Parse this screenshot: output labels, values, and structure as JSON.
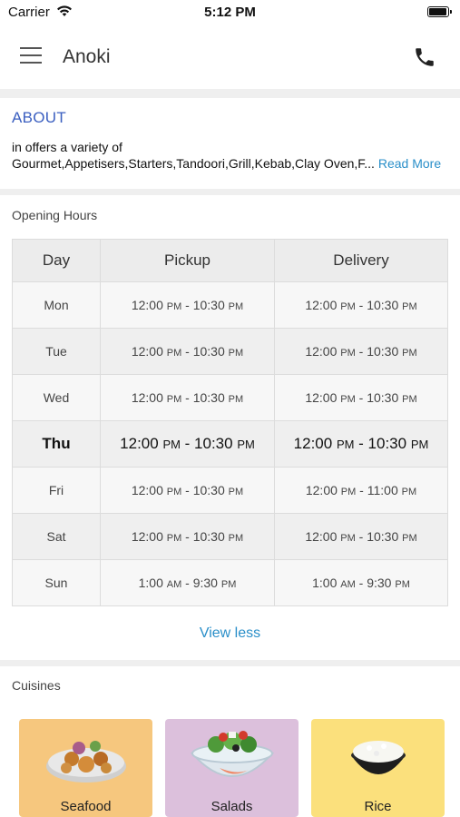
{
  "status_bar": {
    "carrier": "Carrier",
    "time": "5:12 PM"
  },
  "header": {
    "title": "Anoki",
    "menu_icon": "hamburger-icon",
    "call_icon": "phone-icon"
  },
  "about": {
    "heading": "ABOUT",
    "line1": "in  offers a variety of",
    "line2": "Gourmet,Appetisers,Starters,Tandoori,Grill,Kebab,Clay Oven,F...",
    "read_more": "Read More"
  },
  "opening_hours": {
    "heading": "Opening Hours",
    "columns": [
      "Day",
      "Pickup",
      "Delivery"
    ],
    "rows": [
      {
        "day": "Mon",
        "pickup_start": "12:00",
        "pickup_start_ampm": "PM",
        "pickup_end": "10:30",
        "pickup_end_ampm": "PM",
        "delivery_start": "12:00",
        "delivery_start_ampm": "PM",
        "delivery_end": "10:30",
        "delivery_end_ampm": "PM"
      },
      {
        "day": "Tue",
        "pickup_start": "12:00",
        "pickup_start_ampm": "PM",
        "pickup_end": "10:30",
        "pickup_end_ampm": "PM",
        "delivery_start": "12:00",
        "delivery_start_ampm": "PM",
        "delivery_end": "10:30",
        "delivery_end_ampm": "PM"
      },
      {
        "day": "Wed",
        "pickup_start": "12:00",
        "pickup_start_ampm": "PM",
        "pickup_end": "10:30",
        "pickup_end_ampm": "PM",
        "delivery_start": "12:00",
        "delivery_start_ampm": "PM",
        "delivery_end": "10:30",
        "delivery_end_ampm": "PM"
      },
      {
        "day": "Thu",
        "pickup_start": "12:00",
        "pickup_start_ampm": "PM",
        "pickup_end": "10:30",
        "pickup_end_ampm": "PM",
        "delivery_start": "12:00",
        "delivery_start_ampm": "PM",
        "delivery_end": "10:30",
        "delivery_end_ampm": "PM"
      },
      {
        "day": "Fri",
        "pickup_start": "12:00",
        "pickup_start_ampm": "PM",
        "pickup_end": "10:30",
        "pickup_end_ampm": "PM",
        "delivery_start": "12:00",
        "delivery_start_ampm": "PM",
        "delivery_end": "11:00",
        "delivery_end_ampm": "PM"
      },
      {
        "day": "Sat",
        "pickup_start": "12:00",
        "pickup_start_ampm": "PM",
        "pickup_end": "10:30",
        "pickup_end_ampm": "PM",
        "delivery_start": "12:00",
        "delivery_start_ampm": "PM",
        "delivery_end": "10:30",
        "delivery_end_ampm": "PM"
      },
      {
        "day": "Sun",
        "pickup_start": "1:00",
        "pickup_start_ampm": "AM",
        "pickup_end": "9:30",
        "pickup_end_ampm": "PM",
        "delivery_start": "1:00",
        "delivery_start_ampm": "AM",
        "delivery_end": "9:30",
        "delivery_end_ampm": "PM"
      }
    ],
    "toggle_label": "View less"
  },
  "cuisines": {
    "heading": "Cuisines",
    "items": [
      {
        "label": "Seafood",
        "icon": "seafood-bowl-icon",
        "color": "#f6c77e"
      },
      {
        "label": "Salads",
        "icon": "salad-bowl-icon",
        "color": "#dcc0dc"
      },
      {
        "label": "Rice",
        "icon": "rice-bowl-icon",
        "color": "#fbe07c"
      }
    ]
  },
  "colors": {
    "accent_blue": "#3b5fc0",
    "link_blue": "#2a8fc9",
    "divider": "#efefef"
  }
}
